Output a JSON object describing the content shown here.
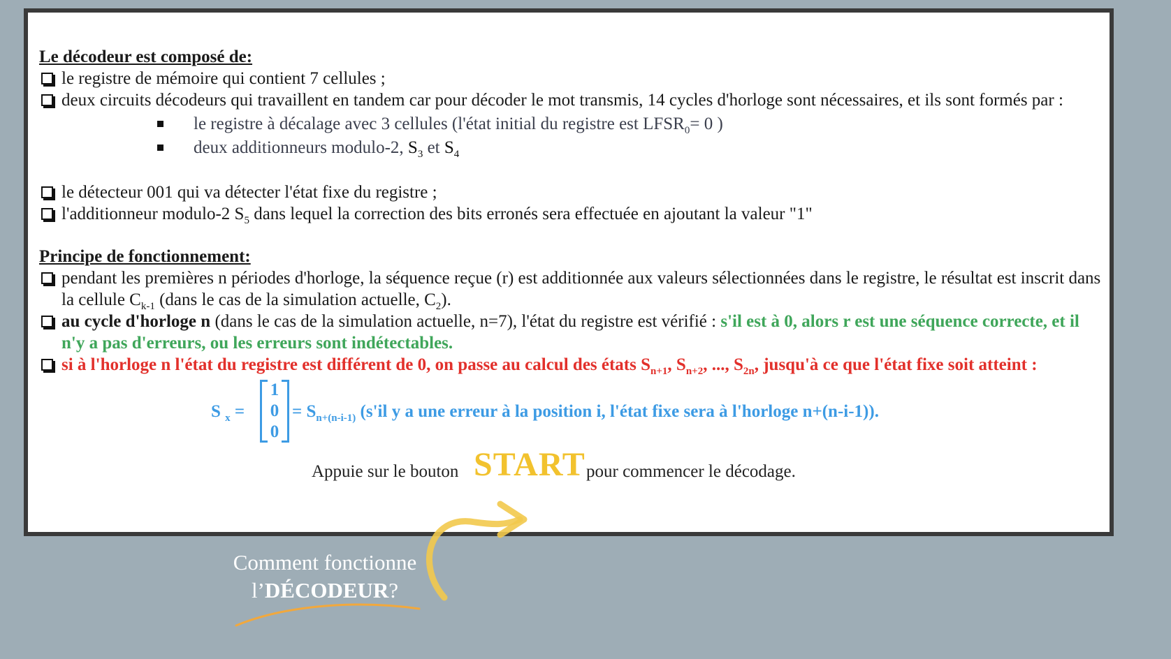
{
  "decoder": {
    "heading": "Le décodeur est composé de:",
    "items": [
      "le registre de mémoire qui contient 7 cellules ;",
      "deux circuits décodeurs qui travaillent en tandem car pour décoder le mot transmis, 14 cycles d'horloge sont nécessaires, et ils sont formés par :"
    ],
    "subitems": {
      "lfsr_text": "le registre à décalage avec 3 cellules (l'état initial du registre est LFSR",
      "lfsr_sub": "0",
      "lfsr_tail": "= 0 )",
      "adders_text": "deux additionneurs modulo-2, ",
      "s3": "S",
      "s3_sub": "3",
      "and": " et ",
      "s4": "S",
      "s4_sub": "4"
    },
    "detector": "le détecteur 001 qui va détecter l'état fixe du registre ;",
    "adder_pre": "l'additionneur modulo-2 S",
    "adder_sub": "5",
    "adder_post": " dans lequel la correction des bits erronés sera effectuée en ajoutant la valeur \"1\""
  },
  "principle": {
    "heading": "Principe de fonctionnement:",
    "p1_pre": "pendant les premières n périodes d'horloge, la séquence reçue (r) est additionnée aux valeurs sélectionnées dans le registre, le résultat est inscrit dans la cellule C",
    "p1_sub": "k-1",
    "p1_mid": " (dans le cas de la simulation actuelle, C",
    "p1_sub2": "2",
    "p1_end": ").",
    "p2_bold": "au cycle d'horloge n",
    "p2_normal": " (dans le cas de la simulation actuelle, n=7), l'état du registre est vérifié : ",
    "p2_green": "s'il est à 0, alors r est une séquence correcte, et il n'y a pas d'erreurs, ou les erreurs sont indétectables.",
    "p3_a": "si à l'horloge n l'état du registre est différent de 0, on passe au calcul des états S",
    "p3_sub1": "n+1",
    "p3_b": ", S",
    "p3_sub2": "n+2",
    "p3_c": ", ..., S",
    "p3_sub3": "2n",
    "p3_d": ", jusqu'à ce que l'état fixe soit atteint :"
  },
  "formula": {
    "lhs": "S",
    "lhs_sub": "x",
    "eq": " =",
    "matrix": [
      "1",
      "0",
      "0"
    ],
    "rhs": "= S",
    "rhs_sub": "n+(n-i-1)",
    "rhs_tail": " (s'il y a une erreur à la position i, l'état fixe sera à l'horloge n+(n-i-1))."
  },
  "start": {
    "pre": "Appuie sur le bouton",
    "button": "START",
    "post": "pour commencer le décodage."
  },
  "help": {
    "line1": "Comment fonctionne",
    "line2_pre": "l’",
    "line2_bold": "DÉCODEUR",
    "line2_post": "?"
  },
  "colors": {
    "background": "#9eadb6",
    "green": "#3fa65a",
    "red": "#e2302b",
    "blue": "#3d9be4",
    "start": "#f2c22e"
  }
}
